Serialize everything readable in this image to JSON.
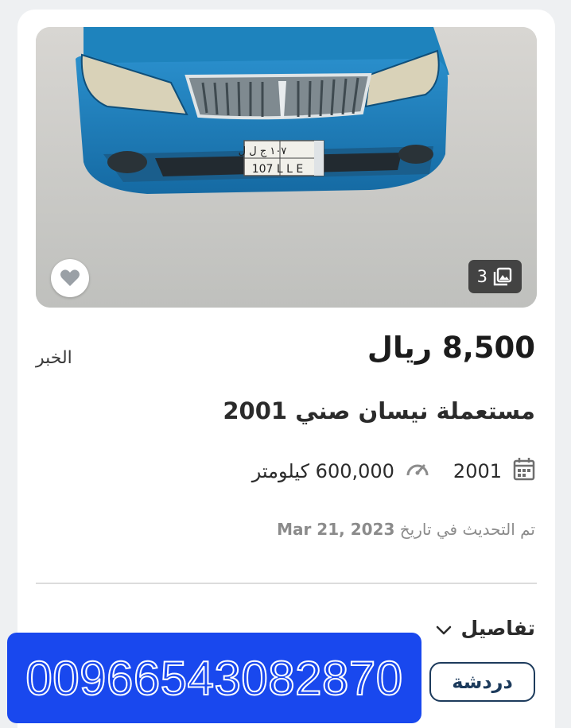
{
  "listing": {
    "price": "8,500 ريال",
    "city": "الخبر",
    "title": "مستعملة نيسان صني 2001",
    "year": "2001",
    "mileage": "600,000 كيلومتر",
    "updated_prefix": "تم التحديث في تاريخ",
    "updated_date": "Mar 21, 2023",
    "photo_count": "3",
    "plate_top": "١٠٧ ج ل ل",
    "plate_bottom": "107 L L E"
  },
  "actions": {
    "details_label": "تفاصيل",
    "chat_label": "دردشة",
    "phone_number": "00966543082870"
  },
  "icons": {
    "favorite": "heart-icon",
    "gallery": "gallery-icon",
    "calendar": "calendar-icon",
    "mileage": "speedometer-icon",
    "details": "chevron-down-icon"
  },
  "colors": {
    "banner": "#1948ee",
    "chat_border": "#1d3b5c",
    "car_body": "#1b7fb8"
  }
}
